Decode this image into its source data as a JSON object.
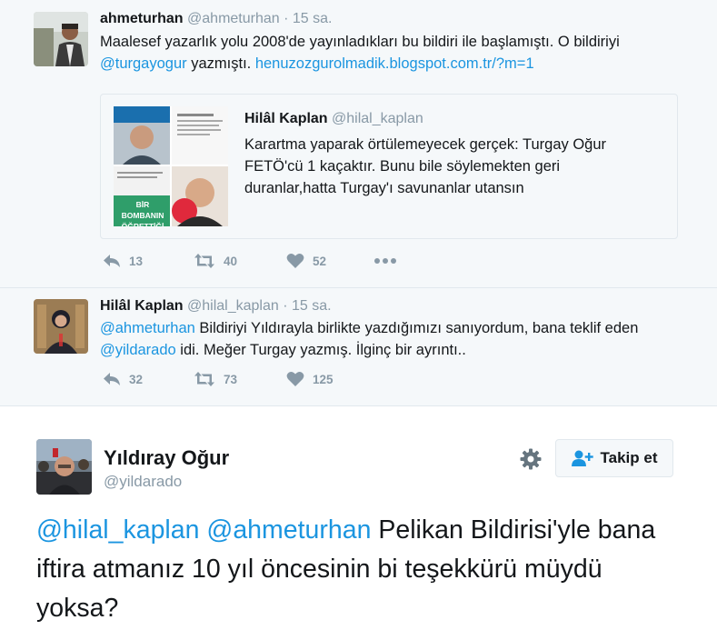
{
  "tweet1": {
    "name": "ahmeturhan",
    "screen_name": "@ahmeturhan",
    "dot": "·",
    "time": "15 sa.",
    "text_part1": "Maalesef yazarlık yolu 2008'de yayınladıkları bu bildiri ile başlamıştı. O bildiriyi ",
    "mention": "@turgayogur",
    "text_part2": " yazmıştı. ",
    "link": "henuzozgurolmadik.blogspot.com.tr/?m=1",
    "quote": {
      "name": "Hilâl Kaplan",
      "screen_name": "@hilal_kaplan",
      "text": "Karartma yaparak örtülemeyecek gerçek: Turgay Oğur FETÖ'cü 1 kaçaktır. Bunu bile söylemekten geri duranlar,hatta Turgay'ı savunanlar utansın",
      "image_overlay_text": "BİR BOMBANIN ÖĞRETTİĞİ"
    },
    "replies": "13",
    "retweets": "40",
    "likes": "52"
  },
  "tweet2": {
    "name": "Hilâl Kaplan",
    "screen_name": "@hilal_kaplan",
    "dot": "·",
    "time": "15 sa.",
    "mention1": "@ahmeturhan",
    "text_part1": " Bildiriyi Yıldırayla birlikte yazdığımızı sanıyordum, bana teklif eden ",
    "mention2": "@yildarado",
    "text_part2": " idi. Meğer Turgay yazmış. İlginç bir ayrıntı..",
    "replies": "32",
    "retweets": "73",
    "likes": "125"
  },
  "main": {
    "name": "Yıldıray Oğur",
    "screen_name": "@yildarado",
    "follow_label": "Takip et",
    "mention1": "@hilal_kaplan",
    "mention2": "@ahmeturhan",
    "text": " Pelikan Bildirisi'yle bana iftira atmanız 10 yıl öncesinin bi teşekkürü müydü yoksa?"
  },
  "colors": {
    "link": "#1b95e0",
    "muted": "#8899a6",
    "thread_bg": "#f5f8fa",
    "border": "#e1e8ed"
  },
  "icons": [
    "reply-icon",
    "retweet-icon",
    "like-icon",
    "more-icon",
    "gear-icon",
    "follow-person-icon"
  ]
}
